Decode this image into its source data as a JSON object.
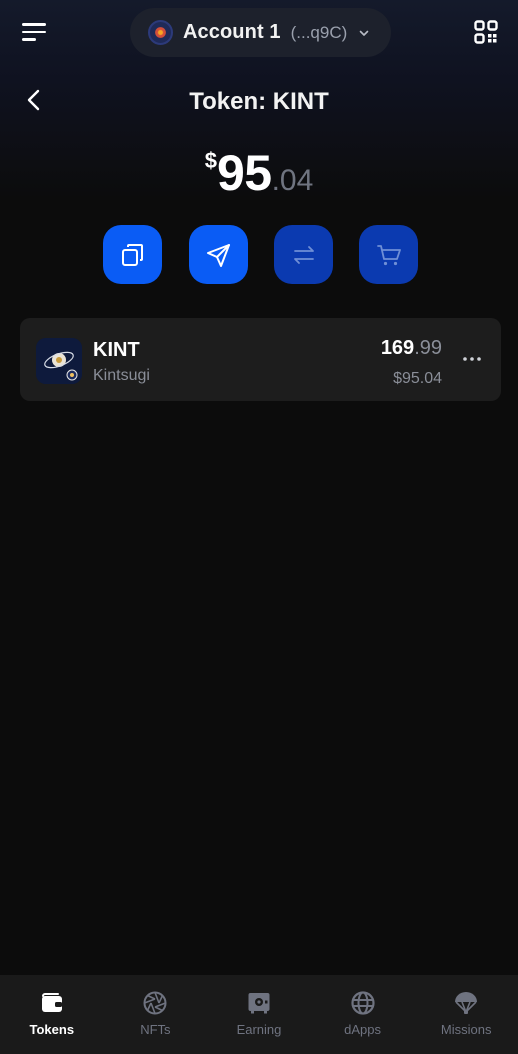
{
  "account": {
    "name": "Account 1",
    "address": "(...q9C)"
  },
  "header": {
    "title": "Token: KINT"
  },
  "balance": {
    "currency_symbol": "$",
    "integer": "95",
    "decimal": ".04"
  },
  "actions": [
    {
      "icon": "copy-icon"
    },
    {
      "icon": "send-icon"
    },
    {
      "icon": "swap-icon"
    },
    {
      "icon": "cart-icon"
    }
  ],
  "token": {
    "symbol": "KINT",
    "name": "Kintsugi",
    "amount_int": "169",
    "amount_dec": ".99",
    "fiat": "$95.04"
  },
  "nav": {
    "items": [
      {
        "label": "Tokens",
        "icon": "wallet-icon",
        "active": true
      },
      {
        "label": "NFTs",
        "icon": "aperture-icon",
        "active": false
      },
      {
        "label": "Earning",
        "icon": "safe-icon",
        "active": false
      },
      {
        "label": "dApps",
        "icon": "globe-icon",
        "active": false
      },
      {
        "label": "Missions",
        "icon": "parachute-icon",
        "active": false
      }
    ]
  },
  "colors": {
    "primary_action": "#0a5cf5",
    "disabled_action": "#0b3ab0",
    "card_bg": "#1d1d1d",
    "nav_bg": "#1a1a1a"
  }
}
